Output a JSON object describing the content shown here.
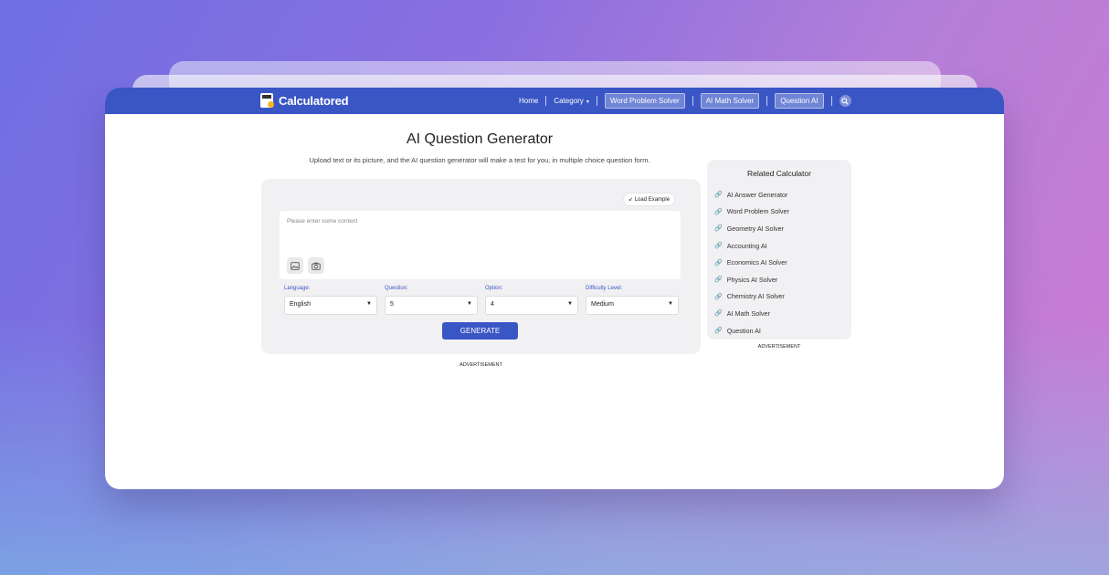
{
  "brand": {
    "name": "Calculatored"
  },
  "nav": {
    "home": "Home",
    "category": "Category",
    "caret": "▾",
    "word_problem_solver": "Word Problem Solver",
    "ai_math_solver": "AI Math Solver",
    "question_ai": "Question AI",
    "search_icon": "search-icon"
  },
  "page": {
    "title": "AI Question Generator",
    "subtitle": "Upload text or its picture, and the AI question generator will make a test for you, in multiple choice question form."
  },
  "form": {
    "load_example": "Load Example",
    "content_placeholder": "Please enter some content",
    "fields": [
      {
        "label": "Language:",
        "value": "English"
      },
      {
        "label": "Question:",
        "value": "5"
      },
      {
        "label": "Option:",
        "value": "4"
      },
      {
        "label": "Difficulty Level:",
        "value": "Medium"
      }
    ],
    "generate": "GENERATE",
    "advertisement": "ADVERTISEMENT"
  },
  "related": {
    "title": "Related Calculator",
    "items": [
      "AI Answer Generator",
      "Word Problem Solver",
      "Geometry AI Solver",
      "Accounting AI",
      "Economics AI Solver",
      "Physics AI Solver",
      "Chemistry AI Solver",
      "AI Math Solver",
      "Question AI"
    ],
    "advertisement": "ADVERTISEMENT"
  },
  "colors": {
    "accent": "#3a56c5",
    "panel": "#f1f1f3"
  }
}
